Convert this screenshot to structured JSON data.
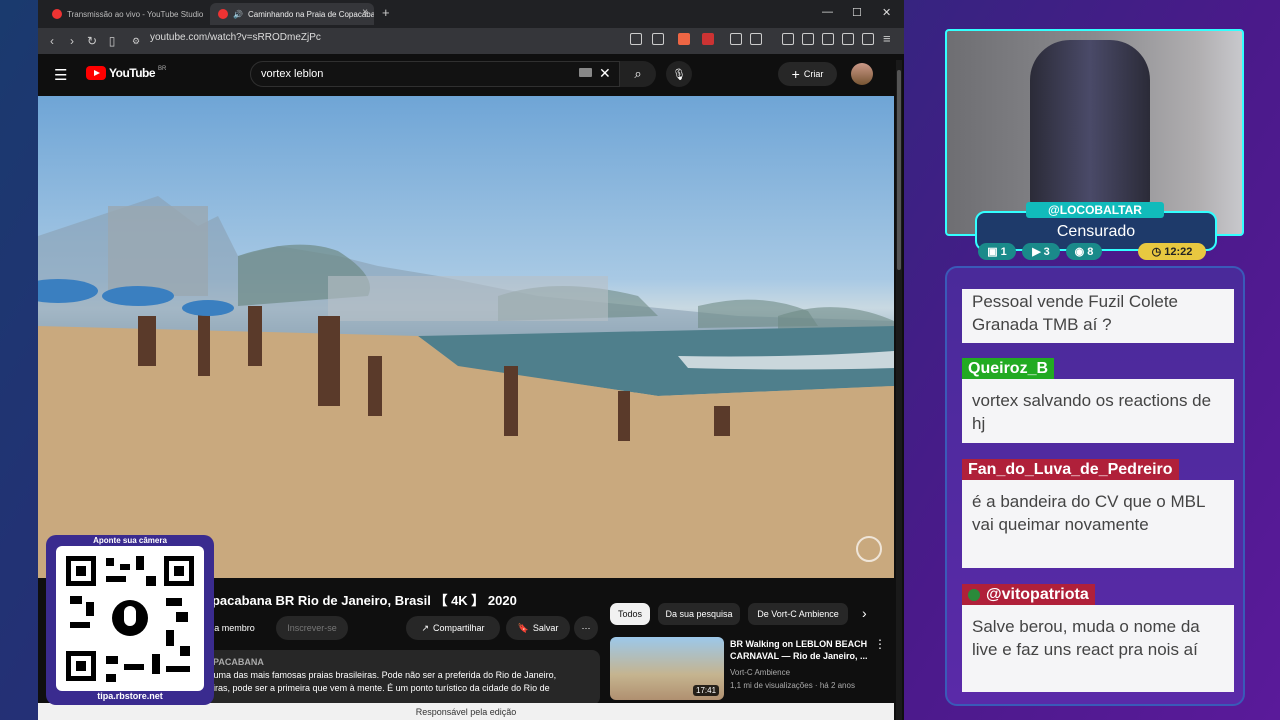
{
  "browser": {
    "tabs": [
      {
        "label": "Transmissão ao vivo - YouTube Studio"
      },
      {
        "label": "Caminhando na Praia de Copacabana"
      }
    ],
    "new_tab": "+",
    "window_controls": {
      "minimize": "—",
      "maximize": "☐",
      "close": "✕"
    },
    "url": "youtube.com/watch?v=sRRODmeZjPc"
  },
  "youtube": {
    "logo_text": "YouTube",
    "country": "BR",
    "search_value": "vortex leblon",
    "create_label": "Criar",
    "video_title": "opacabana BR Rio de Janeiro, Brasil 【 4K 】 2020",
    "join_label": "eja membro",
    "subscribe_label": "Inscrever-se",
    "share_label": "Compartilhar",
    "save_label": "Salvar",
    "desc_channel": "OPACABANA",
    "desc_line1": "a uma das mais famosas praias brasileiras. Pode não ser a preferida do Rio de Janeiro,",
    "desc_line2": "leiras, pode ser a primeira que vem à mente. É um ponto turístico da cidade do Rio de",
    "chips": [
      "Todos",
      "Da sua pesquisa",
      "De Vort-C Ambience"
    ],
    "recommended": {
      "title": "BR Walking on LEBLON BEACH CARNAVAL — Rio de Janeiro, ...",
      "channel": "Vort-C Ambience",
      "meta": "1,1 mi de visualizações · há 2 anos",
      "duration": "17:41"
    },
    "footer": "Responsável pela edição"
  },
  "qr": {
    "top_text": "Aponte sua câmera",
    "bottom_text": "tipa.rbstore.net"
  },
  "webcam": {
    "username": "@LOCOBALTAR",
    "title": "Censurado",
    "stats": {
      "chat": "1",
      "youtube": "3",
      "viewers": "8",
      "time": "12:22"
    }
  },
  "chat": [
    {
      "user": "",
      "text": "Pessoal vende Fuzil Colete Granada TMB aí ?"
    },
    {
      "user": "Queiroz_B",
      "text": "vortex salvando os reactions de hj",
      "color": "#22aa22"
    },
    {
      "user": "Fan_do_Luva_de_Pedreiro",
      "text": "é a bandeira do CV que o MBL vai queimar novamente",
      "color": "#b0203a"
    },
    {
      "user": "@vitopatriota",
      "text": "Salve berou, muda o nome da live e faz uns react pra nois aí",
      "color": "#b0203a"
    }
  ]
}
